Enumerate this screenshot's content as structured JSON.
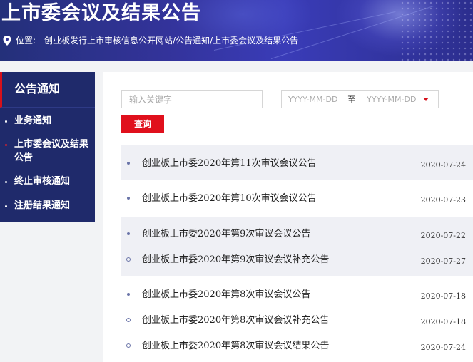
{
  "header": {
    "title": "上市委会议及结果公告",
    "breadcrumb_label": "位置:",
    "breadcrumb_path": "创业板发行上市审核信息公开网站/公告通知/上市委会议及结果公告",
    "pin_icon": "location-pin-icon"
  },
  "sidebar": {
    "heading": "公告通知",
    "items": [
      {
        "label": "业务通知",
        "active": false
      },
      {
        "label": "上市委会议及结果公告",
        "active": true
      },
      {
        "label": "终止审核通知",
        "active": false
      },
      {
        "label": "注册结果通知",
        "active": false
      }
    ]
  },
  "search": {
    "placeholder": "输入关键字",
    "date_from_placeholder": "YYYY-MM-DD",
    "date_separator": "至",
    "date_to_placeholder": "YYYY-MM-DD",
    "query_label": "查询"
  },
  "notices": [
    {
      "title": "创业板上市委2020年第11次审议会议公告",
      "date": "2020-07-24",
      "marker": "dot"
    },
    {
      "title": "创业板上市委2020年第10次审议会议公告",
      "date": "2020-07-23",
      "marker": "dot"
    },
    {
      "title": "创业板上市委2020年第9次审议会议公告",
      "date": "2020-07-22",
      "marker": "dot"
    },
    {
      "title": "创业板上市委2020年第9次审议会议补充公告",
      "date": "2020-07-27",
      "marker": "ring"
    },
    {
      "title": "创业板上市委2020年第8次审议会议公告",
      "date": "2020-07-18",
      "marker": "dot"
    },
    {
      "title": "创业板上市委2020年第8次审议会议补充公告",
      "date": "2020-07-18",
      "marker": "ring"
    },
    {
      "title": "创业板上市委2020年第8次审议会议结果公告",
      "date": "2020-07-24",
      "marker": "ring"
    }
  ],
  "colors": {
    "brand_red": "#e0101c",
    "sidebar_navy": "#1f2a6b",
    "banner_blue": "#33339a"
  }
}
